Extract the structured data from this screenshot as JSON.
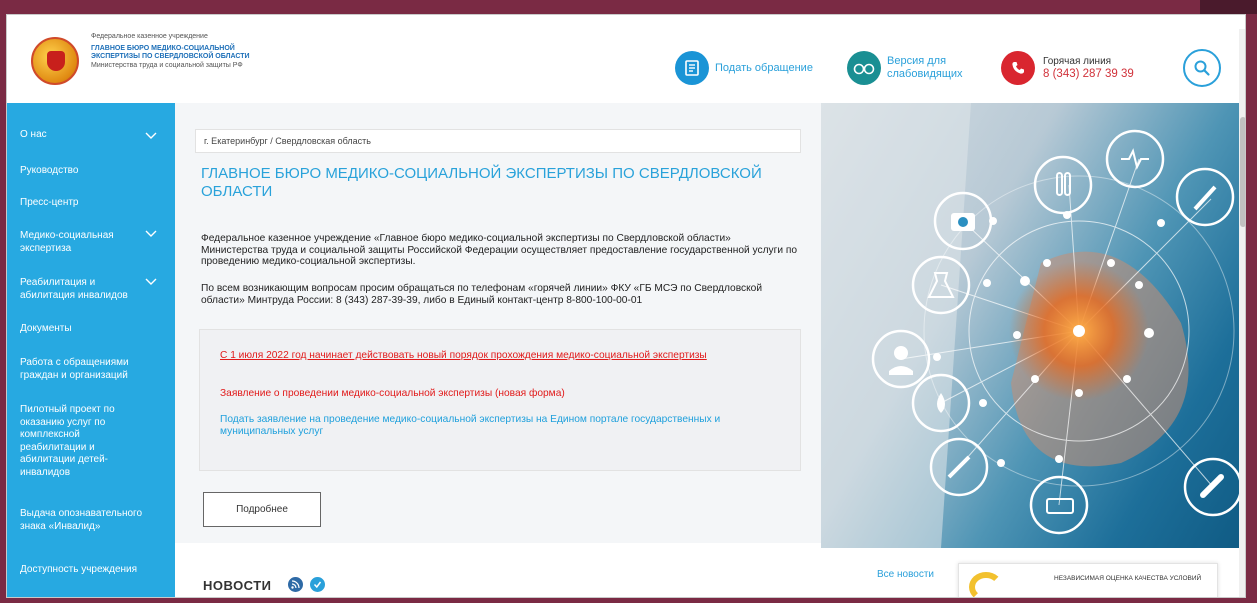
{
  "header": {
    "org_line1": "Федеральное казенное учреждение",
    "org_line2": "ГЛАВНОЕ БЮРО МЕДИКО-СОЦИАЛЬНОЙ",
    "org_line3": "ЭКСПЕРТИЗЫ ПО СВЕРДЛОВСКОЙ ОБЛАСТИ",
    "org_line4": "Министерства труда и социальной защиты РФ",
    "appeal_label": "Подать обращение",
    "low_vision_line1": "Версия для",
    "low_vision_line2": "слабовидящих",
    "hotline_label": "Горячая линия",
    "hotline_phone": "8 (343) 287 39 39"
  },
  "sidebar": {
    "items": [
      {
        "label": "О нас",
        "has_submenu": true
      },
      {
        "label": "Руководство",
        "has_submenu": false
      },
      {
        "label": "Пресс-центр",
        "has_submenu": false
      },
      {
        "label": "Медико-социальная экспертиза",
        "has_submenu": true
      },
      {
        "label": "Реабилитация и абилитация инвалидов",
        "has_submenu": true
      },
      {
        "label": "Документы",
        "has_submenu": false
      },
      {
        "label": "Работа с обращениями граждан и организаций",
        "has_submenu": false
      },
      {
        "label": "Пилотный проект по оказанию услуг по комплексной реабилитации и абилитации детей-инвалидов",
        "has_submenu": false
      },
      {
        "label": "Выдача опознавательного знака «Инвалид»",
        "has_submenu": false
      },
      {
        "label": "Доступность учреждения",
        "has_submenu": false
      }
    ]
  },
  "main": {
    "breadcrumb": "г. Екатеринбург / Свердловская область",
    "title": "ГЛАВНОЕ БЮРО МЕДИКО-СОЦИАЛЬНОЙ ЭКСПЕРТИЗЫ ПО СВЕРДЛОВСКОЙ ОБЛАСТИ",
    "paragraph1": "Федеральное казенное учреждение «Главное бюро медико-социальной экспертизы по Свердловской области» Министерства труда и социальной защиты Российской Федерации осуществляет предоставление государственной услуги по проведению медико-социальной экспертизы.",
    "paragraph2": "По всем возникающим вопросам просим обращаться по телефонам «горячей линии» ФКУ «ГБ МСЭ по Свердловской области» Минтруда России: 8 (343) 287-39-39, либо в Единый контакт-центр  8-800-100-00-01",
    "notice_link1": "С 1 июля 2022 год начинает действовать новый порядок прохождения медико-социальной экспертизы",
    "notice_link2": "Заявление о проведении медико-социальной экспертизы (новая форма)",
    "notice_link3": "Подать заявление на проведение медико-социальной экспертизы на Едином портале государственных и муниципальных услуг",
    "more_button": "Подробнее"
  },
  "news": {
    "title": "НОВОСТИ",
    "all_news": "Все новости",
    "banner_text": "НЕЗАВИСИМАЯ ОЦЕНКА КАЧЕСТВА УСЛОВИЙ"
  },
  "colors": {
    "sidebar": "#27a9e1",
    "accent_blue": "#29a2da",
    "alert_red": "#e11a1a",
    "frame": "#7a2a44"
  }
}
